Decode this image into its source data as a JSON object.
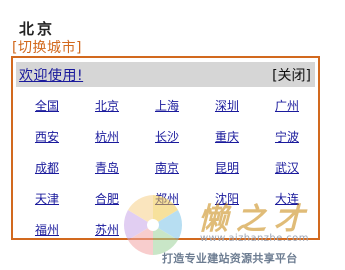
{
  "header": {
    "city": "北京",
    "switch_label": "[切换城市]"
  },
  "popup": {
    "welcome_label": "欢迎使用!",
    "close_label": "[关闭]",
    "cities": [
      [
        "全国",
        "北京",
        "上海",
        "深圳",
        "广州"
      ],
      [
        "西安",
        "杭州",
        "长沙",
        "重庆",
        "宁波"
      ],
      [
        "成都",
        "青岛",
        "南京",
        "昆明",
        "武汉"
      ],
      [
        "天津",
        "合肥",
        "郑州",
        "沈阳",
        "大连"
      ],
      [
        "福州",
        "苏州"
      ]
    ]
  },
  "watermark": {
    "brand": "懒之才",
    "url": "www.aizhanzhe.com",
    "slogan": "打造专业建站资源共享平台"
  },
  "colors": {
    "accent": "#d2691e",
    "link": "#1a1a9c",
    "header_bg": "#d6d6d6"
  }
}
